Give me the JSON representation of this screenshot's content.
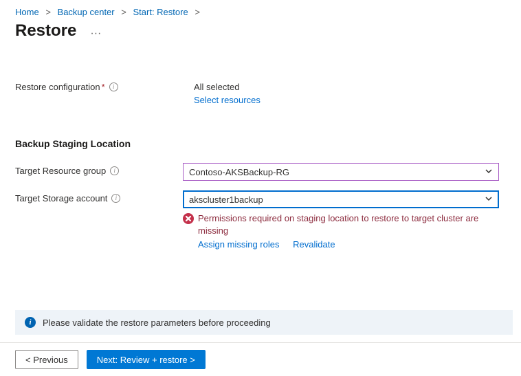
{
  "breadcrumb": {
    "items": [
      {
        "label": "Home"
      },
      {
        "label": "Backup center"
      },
      {
        "label": "Start: Restore"
      }
    ]
  },
  "page": {
    "title": "Restore",
    "more_glyph": "···"
  },
  "config": {
    "label": "Restore configuration",
    "required_mark": "*",
    "value_text": "All selected",
    "select_link": "Select resources"
  },
  "staging": {
    "heading": "Backup Staging Location",
    "targetRG": {
      "label": "Target Resource group",
      "value": "Contoso-AKSBackup-RG"
    },
    "targetStorage": {
      "label": "Target Storage account",
      "value": "akscluster1backup",
      "error": "Permissions required on staging location to restore to target cluster are missing",
      "assign_link": "Assign missing roles",
      "revalidate_link": "Revalidate"
    }
  },
  "banner": {
    "text": "Please validate the restore parameters before proceeding"
  },
  "footer": {
    "prev": "< Previous",
    "next": "Next: Review + restore >"
  },
  "glyphs": {
    "chevronRight": ">",
    "info": "i"
  }
}
